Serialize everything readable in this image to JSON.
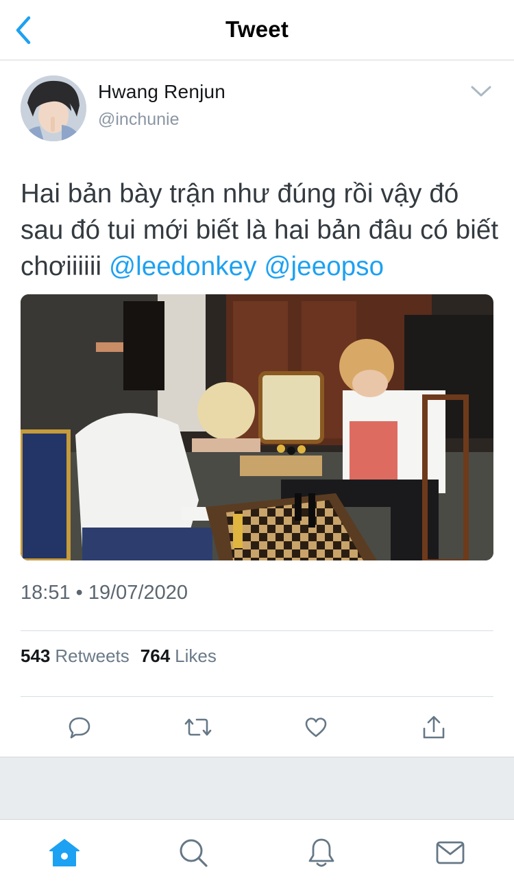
{
  "topbar": {
    "title": "Tweet",
    "back_icon": "chevron-left-icon"
  },
  "author": {
    "display_name": "Hwang Renjun",
    "handle": "@inchunie"
  },
  "tweet": {
    "text_plain": "Hai bản bày trận như đúng rồi vậy đó sau đó tui mới biết là hai bản đâu có biết chơiiiiii ",
    "mention_1": "@leedonkey",
    "mention_2": "@jeeopso",
    "timestamp": "18:51 • 19/07/2020"
  },
  "stats": {
    "retweets_count": "543",
    "retweets_label": "Retweets",
    "likes_count": "764",
    "likes_label": "Likes"
  },
  "actions": [
    "reply-icon",
    "retweet-icon",
    "like-icon",
    "share-icon"
  ],
  "tabbar": [
    "home-icon",
    "search-icon",
    "notifications-icon",
    "messages-icon"
  ],
  "colors": {
    "accent": "#1da1f2",
    "text": "#14171a",
    "secondary": "#8a96a3",
    "icon": "#657786"
  }
}
